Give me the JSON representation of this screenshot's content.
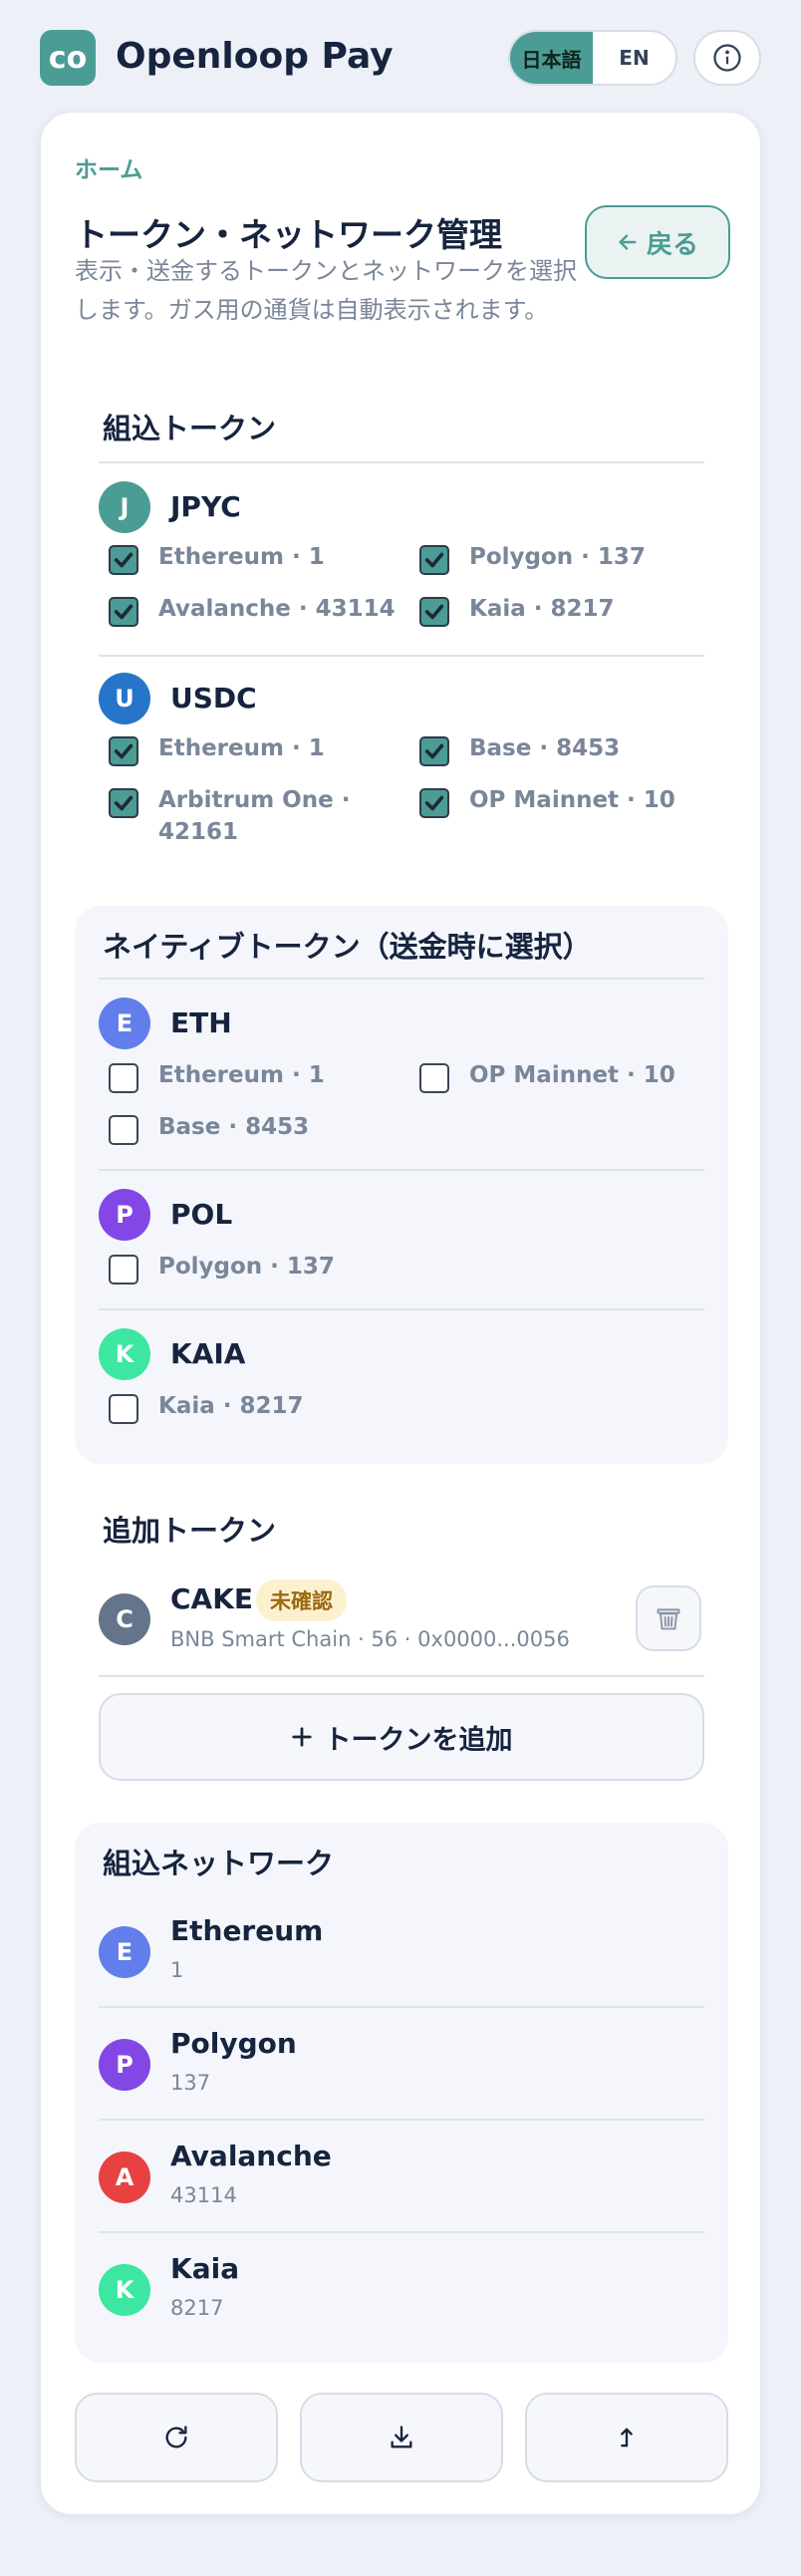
{
  "app": {
    "logo_text": "co",
    "title": "Openloop Pay"
  },
  "lang": {
    "ja": "日本語",
    "en": "EN",
    "active": "ja"
  },
  "breadcrumb": "ホーム",
  "page": {
    "title": "トークン・ネットワーク管理",
    "description": "表示・送金するトークンとネットワークを選択します。ガス用の通貨は自動表示されます。",
    "back_label": "戻る"
  },
  "builtin_tokens": {
    "title": "組込トークン",
    "tokens": [
      {
        "letter": "J",
        "name": "JPYC",
        "color": "#4b9c94",
        "networks": [
          {
            "label": "Ethereum · 1",
            "checked": true
          },
          {
            "label": "Polygon · 137",
            "checked": true
          },
          {
            "label": "Avalanche · 43114",
            "checked": true
          },
          {
            "label": "Kaia · 8217",
            "checked": true
          }
        ]
      },
      {
        "letter": "U",
        "name": "USDC",
        "color": "#2775ca",
        "networks": [
          {
            "label": "Ethereum · 1",
            "checked": true
          },
          {
            "label": "Base · 8453",
            "checked": true
          },
          {
            "label": "Arbitrum One · 42161",
            "checked": true
          },
          {
            "label": "OP Mainnet · 10",
            "checked": true
          }
        ]
      }
    ]
  },
  "native_tokens": {
    "title": "ネイティブトークン（送金時に選択）",
    "tokens": [
      {
        "letter": "E",
        "name": "ETH",
        "color": "#627eea",
        "networks": [
          {
            "label": "Ethereum · 1",
            "checked": false
          },
          {
            "label": "OP Mainnet · 10",
            "checked": false
          },
          {
            "label": "Base · 8453",
            "checked": false
          }
        ]
      },
      {
        "letter": "P",
        "name": "POL",
        "color": "#8247e5",
        "networks": [
          {
            "label": "Polygon · 137",
            "checked": false
          }
        ]
      },
      {
        "letter": "K",
        "name": "KAIA",
        "color": "#3de6a1",
        "networks": [
          {
            "label": "Kaia · 8217",
            "checked": false
          }
        ]
      }
    ]
  },
  "added_tokens": {
    "title": "追加トークン",
    "items": [
      {
        "letter": "C",
        "name": "CAKE",
        "badge": "未確認",
        "detail": "BNB Smart Chain · 56 · 0x0000...0056",
        "color": "#64748b"
      }
    ],
    "add_label": "トークンを追加"
  },
  "builtin_networks": {
    "title": "組込ネットワーク",
    "items": [
      {
        "letter": "E",
        "name": "Ethereum",
        "id": "1",
        "color": "#627eea"
      },
      {
        "letter": "P",
        "name": "Polygon",
        "id": "137",
        "color": "#8247e5"
      },
      {
        "letter": "A",
        "name": "Avalanche",
        "id": "43114",
        "color": "#e84142"
      },
      {
        "letter": "K",
        "name": "Kaia",
        "id": "8217",
        "color": "#3de6a1"
      }
    ]
  },
  "footer": {
    "icons": [
      "refresh-icon",
      "download-icon",
      "upload-icon"
    ]
  }
}
